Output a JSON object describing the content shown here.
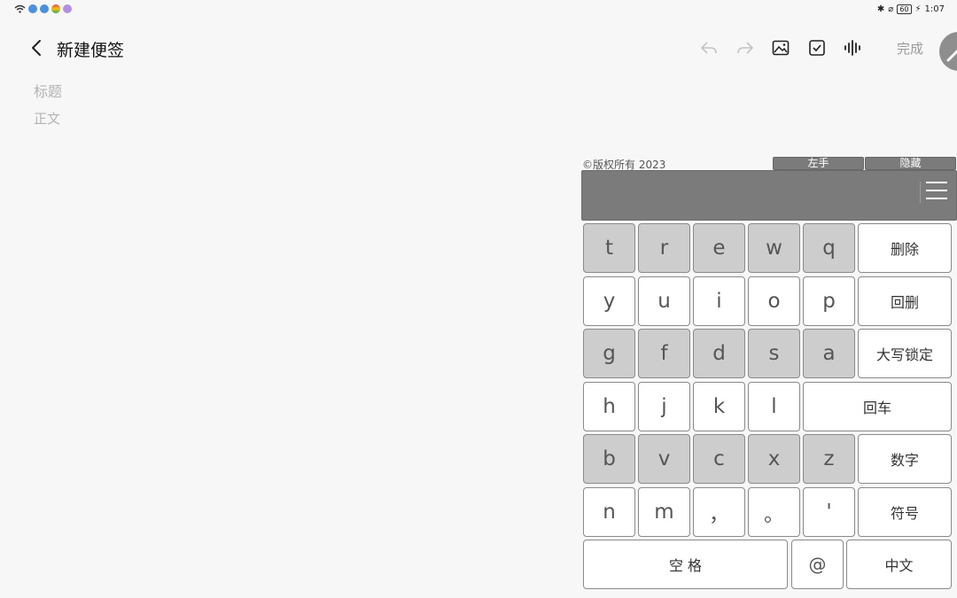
{
  "status_bar": {
    "notification_icons": [
      "wifi-icon",
      "app-badge-icon",
      "app-badge-icon",
      "colorful-app-icon",
      "purple-app-icon"
    ],
    "battery": "60",
    "time": "1:07",
    "icons": [
      "bluetooth-icon",
      "mute-icon",
      "battery-icon",
      "charging-icon"
    ]
  },
  "header": {
    "title": "新建便签",
    "done_label": "完成",
    "tools": [
      "undo-icon",
      "redo-icon",
      "image-icon",
      "checkbox-icon",
      "voice-icon"
    ]
  },
  "editor": {
    "title_placeholder": "标题",
    "body_placeholder": "正文"
  },
  "keyboard": {
    "copyright": "©版权所有 2023",
    "left_hand_label": "左手",
    "hide_label": "隐藏",
    "rows": [
      [
        "t",
        "r",
        "e",
        "w",
        "q",
        "删除"
      ],
      [
        "y",
        "u",
        "i",
        "o",
        "p",
        "回删"
      ],
      [
        "g",
        "f",
        "d",
        "s",
        "a",
        "大写锁定"
      ],
      [
        "h",
        "j",
        "k",
        "l",
        "回车"
      ],
      [
        "b",
        "v",
        "c",
        "x",
        "z",
        "数字"
      ],
      [
        "n",
        "m",
        "，",
        "。",
        "'",
        "符号"
      ],
      [
        "空 格",
        "@",
        "中文"
      ]
    ]
  },
  "colors": {
    "background": "#f7f7f7",
    "key_gray": "#cdcdcd",
    "key_white": "#ffffff",
    "bar_gray": "#7b7b7b"
  }
}
